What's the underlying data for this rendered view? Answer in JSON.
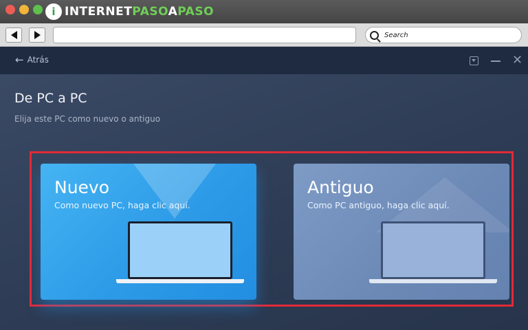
{
  "browser": {
    "logo_mark": "i",
    "logo_text_a": "INTERNET",
    "logo_text_b": "PASO",
    "logo_text_c": "A",
    "logo_text_d": "PASO",
    "search_placeholder": "Search",
    "icons": [
      "back-arrow-icon",
      "forward-arrow-icon",
      "search-icon"
    ]
  },
  "app": {
    "back_label": "Atrás",
    "title": "De PC a PC",
    "subtitle": "Elija este PC como nuevo o antiguo",
    "cards": [
      {
        "title": "Nuevo",
        "subtitle": "Como nuevo PC, haga clic aquí."
      },
      {
        "title": "Antiguo",
        "subtitle": "Como PC antiguo, haga clic aquí."
      }
    ],
    "colors": {
      "highlight": "#e32a36",
      "new_card": "#2d9be7",
      "old_card": "#6c89b6"
    }
  }
}
